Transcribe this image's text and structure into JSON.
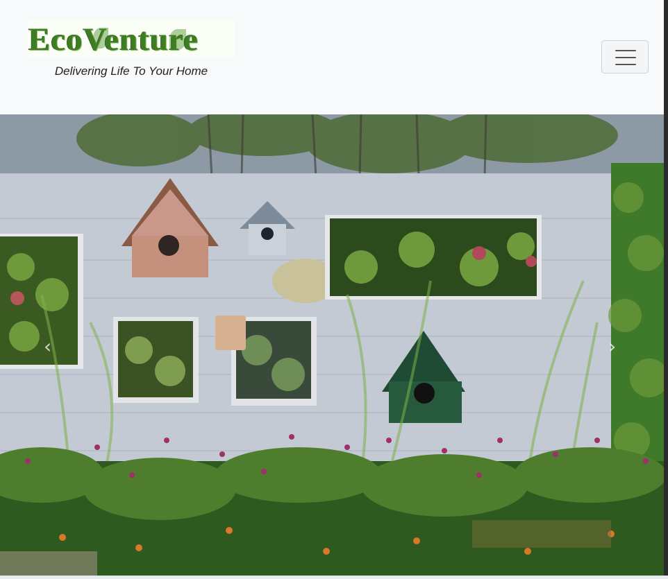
{
  "brand": {
    "logo_text": "EcoVenture",
    "tagline": "Delivering Life To Your Home"
  },
  "navbar": {
    "toggler_icon": "hamburger-icon"
  },
  "carousel": {
    "prev_icon": "chevron-left-icon",
    "next_icon": "chevron-right-icon",
    "prev_glyph": "‹",
    "next_glyph": "›",
    "colors": {
      "fence": "#c4cad3",
      "foliage_dark": "#2f5a1f",
      "foliage_light": "#6e9a3c",
      "flowers": "#a0306b",
      "orange_flowers": "#d9782a",
      "sky_trees": "#4d6b35"
    }
  }
}
